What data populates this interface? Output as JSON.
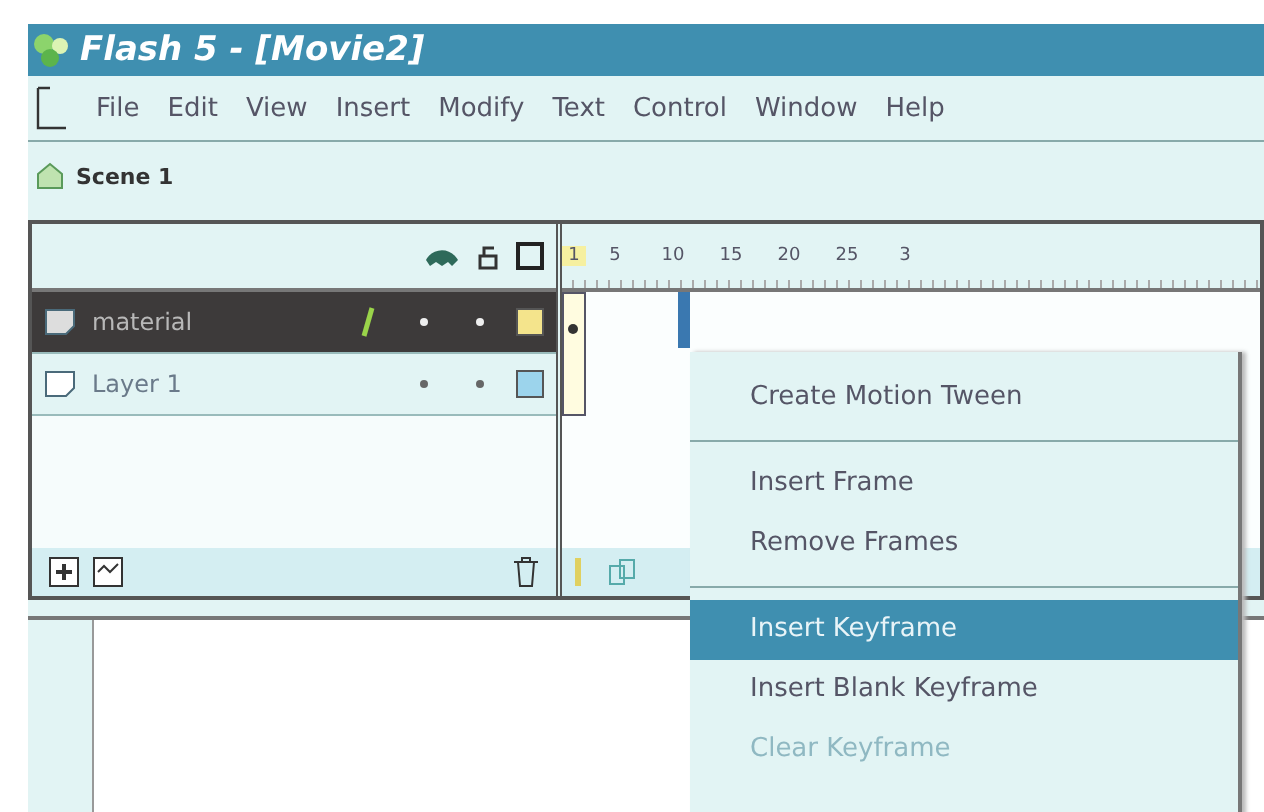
{
  "window": {
    "title": "Flash 5 - [Movie2]"
  },
  "menu_bar": [
    "File",
    "Edit",
    "View",
    "Insert",
    "Modify",
    "Text",
    "Control",
    "Window",
    "Help"
  ],
  "scene": {
    "label": "Scene 1"
  },
  "timeline": {
    "ruler": [
      "1",
      "5",
      "10",
      "15",
      "20",
      "25",
      "3"
    ],
    "layers": [
      {
        "name": "material",
        "selected": true,
        "color": "#f4e48c"
      },
      {
        "name": "Layer 1",
        "selected": false,
        "color": "#9cd4ec"
      }
    ]
  },
  "context_menu": [
    {
      "kind": "item",
      "label": "Create Motion Tween",
      "selected": false,
      "disabled": false
    },
    {
      "kind": "separator"
    },
    {
      "kind": "item",
      "label": "Insert Frame",
      "selected": false,
      "disabled": false
    },
    {
      "kind": "item",
      "label": "Remove Frames",
      "selected": false,
      "disabled": false
    },
    {
      "kind": "separator"
    },
    {
      "kind": "item",
      "label": "Insert Keyframe",
      "selected": true,
      "disabled": false
    },
    {
      "kind": "item",
      "label": "Insert Blank Keyframe",
      "selected": false,
      "disabled": false
    },
    {
      "kind": "item",
      "label": "Clear Keyframe",
      "selected": false,
      "disabled": true
    }
  ]
}
